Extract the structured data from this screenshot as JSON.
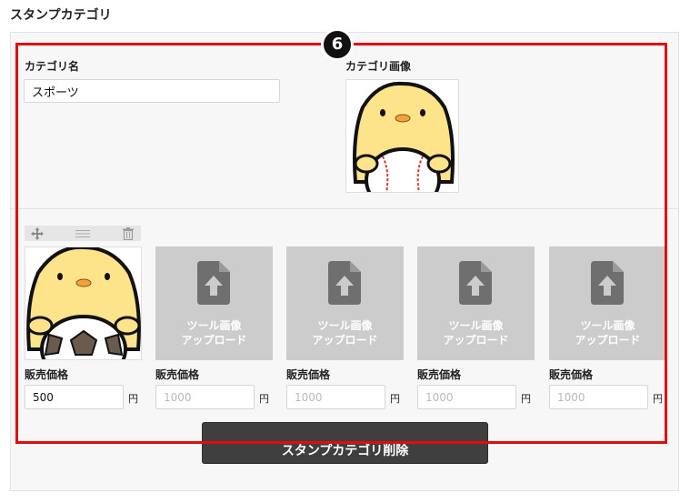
{
  "page": {
    "title": "スタンプカテゴリ"
  },
  "category": {
    "name_label": "カテゴリ名",
    "name_value": "スポーツ",
    "image_label": "カテゴリ画像"
  },
  "stamps": {
    "price_label": "販売価格",
    "currency": "円",
    "upload_text_line1": "ツール画像",
    "upload_text_line2": "アップロード",
    "price_placeholder": "1000",
    "first_price": "500",
    "toolbar_icons": [
      "move-icon",
      "reorder-icon",
      "trash-icon"
    ]
  },
  "actions": {
    "delete_label": "スタンプカテゴリ削除"
  },
  "annotation": {
    "badge": "6",
    "color": "#e40b0b"
  }
}
